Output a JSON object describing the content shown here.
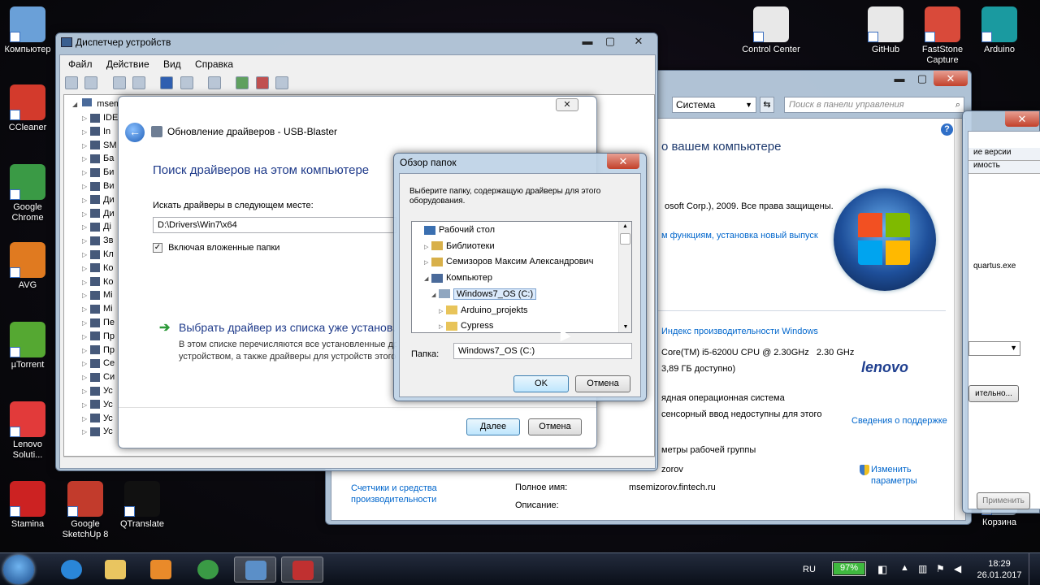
{
  "desktop_icons_left": [
    {
      "label": "Компьютер",
      "icon": "computer-icon",
      "color": "#6aa0d8"
    },
    {
      "label": "CCleaner",
      "icon": "ccleaner-icon",
      "color": "#d33a2c"
    },
    {
      "label": "Google Chrome",
      "icon": "chrome-icon",
      "color": "#3a9a45"
    },
    {
      "label": "AVG",
      "icon": "avg-icon",
      "color": "#e07a20"
    },
    {
      "label": "µTorrent",
      "icon": "utorrent-icon",
      "color": "#55a832"
    },
    {
      "label": "Lenovo Soluti...",
      "icon": "lenovo-solutions-icon",
      "color": "#e23a3a"
    },
    {
      "label": "Stamina",
      "icon": "stamina-icon",
      "color": "#cc2222"
    },
    {
      "label": "Google SketchUp 8",
      "icon": "sketchup-icon",
      "color": "#c23b2c"
    },
    {
      "label": "QTranslate",
      "icon": "qtranslate-icon",
      "color": "#111111"
    }
  ],
  "desktop_icons_right": [
    {
      "label": "Control Center",
      "icon": "control-center-icon",
      "color": "#e8e8e8"
    },
    {
      "label": "GitHub",
      "icon": "github-icon",
      "color": "#e8e8e8"
    },
    {
      "label": "FastStone Capture",
      "icon": "faststone-icon",
      "color": "#d94a3a"
    },
    {
      "label": "Arduino",
      "icon": "arduino-icon",
      "color": "#1a9aa0"
    },
    {
      "label": "Корзина",
      "icon": "recycle-bin-icon",
      "color": "#9bb0c4"
    }
  ],
  "device_manager": {
    "title": "Диспетчер устройств",
    "menu": [
      "Файл",
      "Действие",
      "Вид",
      "Справка"
    ],
    "root": "msemizorov-...",
    "tree_items": [
      "IDE",
      "In",
      "SM",
      "Ба",
      "Би",
      "Ви",
      "Ди",
      "Ди",
      "Дi",
      "Зв",
      "Кл",
      "Ко",
      "Ко",
      "Mi",
      "Mi",
      "Пе",
      "Пр",
      "Пр",
      "Се",
      "Си",
      "Ус",
      "Ус",
      "Ус",
      "Ус"
    ]
  },
  "driver_update": {
    "title": "Обновление драйверов - USB-Blaster",
    "heading": "Поиск драйверов на этом компьютере",
    "search_label": "Искать драйверы в следующем месте:",
    "path_value": "D:\\Drivers\\Win7\\x64",
    "include_subfolders": "Включая вложенные папки",
    "pick_option": "Выбрать драйвер из списка уже установ...",
    "pick_desc_1": "В этом списке перечисляются все установленные драй...",
    "pick_desc_2": "устройством, а также драйверы для устройств этого т...",
    "next": "Далее",
    "cancel": "Отмена"
  },
  "browse": {
    "title": "Обзор папок",
    "instruction": "Выберите папку, содержащую драйверы для этого оборудования.",
    "tree": [
      {
        "label": "Рабочий стол",
        "indent": 0,
        "arrow": "",
        "icon": "desktop-folder-icon",
        "selected": false
      },
      {
        "label": "Библиотеки",
        "indent": 1,
        "arrow": "▷",
        "icon": "libraries-icon",
        "selected": false
      },
      {
        "label": "Семизоров Максим Александрович",
        "indent": 1,
        "arrow": "▷",
        "icon": "user-folder-icon",
        "selected": false
      },
      {
        "label": "Компьютер",
        "indent": 1,
        "arrow": "◢",
        "icon": "computer-icon",
        "selected": false
      },
      {
        "label": "Windows7_OS (C:)",
        "indent": 2,
        "arrow": "◢",
        "icon": "drive-icon",
        "selected": true
      },
      {
        "label": "Arduino_projekts",
        "indent": 3,
        "arrow": "▷",
        "icon": "folder-icon",
        "selected": false
      },
      {
        "label": "Cypress",
        "indent": 3,
        "arrow": "▷",
        "icon": "folder-icon",
        "selected": false
      }
    ],
    "folder_label": "Папка:",
    "folder_value": "Windows7_OS (C:)",
    "ok": "OK",
    "cancel": "Отмена"
  },
  "system": {
    "address": "Система",
    "search_placeholder": "Поиск в панели управления",
    "heading": "о вашем компьютере",
    "copyright": "osoft Corp.), 2009. Все права защищены.",
    "new_features": "м функциям, установка новый выпуск",
    "perf_index": "Индекс производительности Windows",
    "cpu": "Core(TM) i5-6200U CPU @ 2.30GHz   2.30 GHz",
    "ram": "3,89 ГБ доступно)",
    "os_type": "ядная операционная система",
    "touch": "сенсорный ввод недоступны для этого",
    "support_info": "Сведения о поддержке",
    "workgroup": "метры рабочей группы",
    "computer_name_partial": "zorov",
    "change_params_1": "Изменить",
    "change_params_2": "параметры",
    "full_name_label": "Полное имя:",
    "full_name_value": "msemizorov.fintech.ru",
    "description_label": "Описание:",
    "left_link_1": "Счетчики и средства",
    "left_link_2": "производительности",
    "brand": "lenovo"
  },
  "side_window": {
    "tab1": "ие версии",
    "tab2": "имость",
    "file": "quartus.exe",
    "btn": "ительно...",
    "apply": "Применить"
  },
  "taskbar": {
    "lang": "RU",
    "battery": "97%",
    "time": "18:29",
    "date": "26.01.2017",
    "colors": {
      "battery": "#3fb93f"
    }
  }
}
